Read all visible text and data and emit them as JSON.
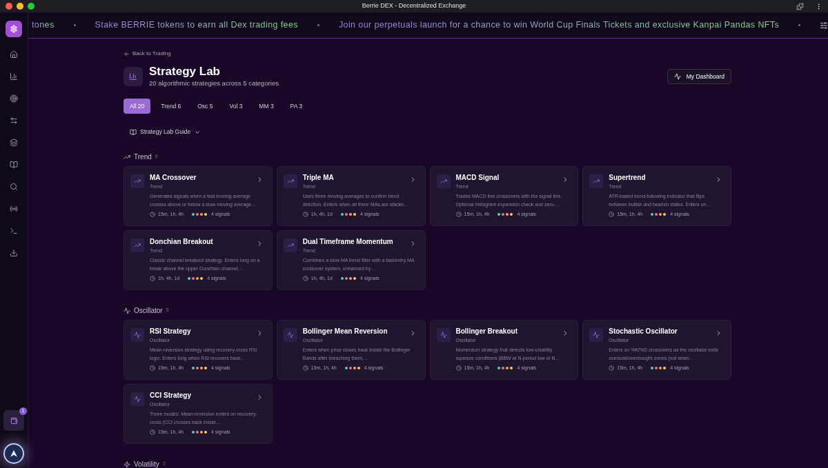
{
  "window": {
    "title": "Berrie DEX - Decentralized Exchange"
  },
  "ticker": [
    {
      "text": "tones"
    },
    {
      "text": "Stake BERRIE tokens to earn all Dex trading fees"
    },
    {
      "text": "Join our perpetuals launch for a chance to win World Cup Finals Tickets and exclusive Kanpai Pandas NFTs"
    }
  ],
  "sidebar": {
    "items": [
      {
        "kind": "home",
        "selected": false
      },
      {
        "kind": "chart",
        "selected": false
      },
      {
        "kind": "target",
        "selected": false
      },
      {
        "kind": "swap",
        "selected": false
      },
      {
        "kind": "layers",
        "selected": false
      },
      {
        "kind": "book",
        "selected": false
      },
      {
        "kind": "search",
        "selected": false
      },
      {
        "kind": "radio",
        "selected": false
      },
      {
        "kind": "terminal",
        "selected": false
      },
      {
        "kind": "download",
        "selected": false
      }
    ],
    "wallet_badge": "1"
  },
  "back_link": "Back to Trading",
  "header": {
    "title": "Strategy Lab",
    "subtitle": "20 algorithmic strategies across 5 categories",
    "dashboard_button": "My Dashboard"
  },
  "tabs": [
    {
      "label": "All 20",
      "selected": true
    },
    {
      "label": "Trend 6",
      "selected": false
    },
    {
      "label": "Osc 5",
      "selected": false
    },
    {
      "label": "Vol 3",
      "selected": false
    },
    {
      "label": "MM 3",
      "selected": false
    },
    {
      "label": "PA 3",
      "selected": false
    }
  ],
  "guide": {
    "label": "Strategy Lab Guide",
    "expanded": false
  },
  "signal_dots": [
    {
      "color": "#5fcfa3"
    },
    {
      "color": "#ec6f8e"
    },
    {
      "color": "#f2a553"
    },
    {
      "color": "#f4cf4f"
    }
  ],
  "sections": [
    {
      "kind": "trend",
      "name": "Trend",
      "count": "6",
      "strategies": [
        {
          "name": "MA Crossover",
          "category": "Trend",
          "description": "Generates signals when a fast moving average crosses above or below a slow moving average…",
          "timeframes": "15m, 1h, 4h",
          "signals": "4 signals"
        },
        {
          "name": "Triple MA",
          "category": "Trend",
          "description": "Uses three moving averages to confirm trend direction. Enters when all three MAs are stacke…",
          "timeframes": "1h, 4h, 1d",
          "signals": "4 signals"
        },
        {
          "name": "MACD Signal",
          "category": "Trend",
          "description": "Trades MACD line crossovers with the signal line. Optional histogram expansion check and zero-…",
          "timeframes": "15m, 1h, 4h",
          "signals": "4 signals"
        },
        {
          "name": "Supertrend",
          "category": "Trend",
          "description": "ATR-based trend-following indicator that flips between bullish and bearish states. Enters on…",
          "timeframes": "15m, 1h, 4h",
          "signals": "4 signals"
        },
        {
          "name": "Donchian Breakout",
          "category": "Trend",
          "description": "Classic channel breakout strategy. Enters long on a break above the upper Donchian channel,…",
          "timeframes": "1h, 4h, 1d",
          "signals": "4 signals"
        },
        {
          "name": "Dual Timeframe Momentum",
          "category": "Trend",
          "description": "Combines a slow MA trend filter with a fast/entry MA crossover system, enhanced by…",
          "timeframes": "1h, 4h, 1d",
          "signals": "4 signals"
        }
      ]
    },
    {
      "kind": "oscillator",
      "name": "Oscillator",
      "count": "5",
      "strategies": [
        {
          "name": "RSI Strategy",
          "category": "Oscillator",
          "description": "Mean-reversion strategy using recovery-cross RSI logic. Enters long when RSI recovers back…",
          "timeframes": "15m, 1h, 4h",
          "signals": "4 signals"
        },
        {
          "name": "Bollinger Mean Reversion",
          "category": "Oscillator",
          "description": "Enters when price closes back inside the Bollinger Bands after breaching them,…",
          "timeframes": "15m, 1h, 4h",
          "signals": "4 signals"
        },
        {
          "name": "Bollinger Breakout",
          "category": "Oscillator",
          "description": "Momentum strategy that detects low-volatility squeeze conditions (BBW at N-period low or B…",
          "timeframes": "15m, 1h, 4h",
          "signals": "4 signals"
        },
        {
          "name": "Stochastic Oscillator",
          "category": "Oscillator",
          "description": "Enters on %K/%D crossovers as the oscillator exits oversold/overbought zones (not when…",
          "timeframes": "15m, 1h, 4h",
          "signals": "4 signals"
        },
        {
          "name": "CCI Strategy",
          "category": "Oscillator",
          "description": "Three modes: Mean-reversion enters on recovery-cross (CCI crosses back inside…",
          "timeframes": "15m, 1h, 4h",
          "signals": "4 signals"
        }
      ]
    },
    {
      "kind": "volatility",
      "name": "Volatility",
      "count": "3"
    }
  ]
}
